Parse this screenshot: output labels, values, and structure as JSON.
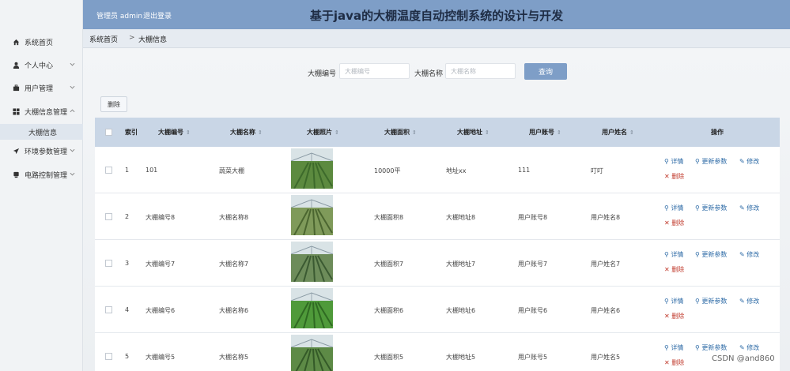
{
  "header": {
    "user": "管理员 admin",
    "logout": "退出登录",
    "title": "基于java的大棚温度自动控制系统的设计与开发"
  },
  "sidebar": {
    "items": [
      {
        "icon": "home-icon",
        "label": "系统首页",
        "chevron": ""
      },
      {
        "icon": "user-icon",
        "label": "个人中心",
        "chevron": "v"
      },
      {
        "icon": "briefcase-icon",
        "label": "用户管理",
        "chevron": "v"
      },
      {
        "icon": "grid-icon",
        "label": "大棚信息管理",
        "chevron": "^"
      },
      {
        "icon": "send-icon",
        "label": "环境参数管理",
        "chevron": "v"
      },
      {
        "icon": "database-icon",
        "label": "电路控制管理",
        "chevron": "v"
      }
    ],
    "subitem": "大棚信息"
  },
  "breadcrumb": {
    "home": "系统首页",
    "separator": ">",
    "current": "大棚信息"
  },
  "search": {
    "no_label": "大棚编号",
    "no_placeholder": "大棚编号",
    "name_label": "大棚名称",
    "name_placeholder": "大棚名称",
    "query_button": "查询"
  },
  "toolbar": {
    "delete_button": "删除"
  },
  "table": {
    "columns": {
      "index": "索引",
      "no": "大棚编号",
      "name": "大棚名称",
      "photo": "大棚照片",
      "area": "大棚面积",
      "address": "大棚地址",
      "account": "用户账号",
      "username": "用户姓名",
      "ops": "操作"
    },
    "rows": [
      {
        "index": "1",
        "no": "101",
        "name": "蔬菜大棚",
        "area": "10000平",
        "address": "地址xx",
        "account": "111",
        "username": "叮叮"
      },
      {
        "index": "2",
        "no": "大棚编号8",
        "name": "大棚名称8",
        "area": "大棚面积8",
        "address": "大棚地址8",
        "account": "用户账号8",
        "username": "用户姓名8"
      },
      {
        "index": "3",
        "no": "大棚编号7",
        "name": "大棚名称7",
        "area": "大棚面积7",
        "address": "大棚地址7",
        "account": "用户账号7",
        "username": "用户姓名7"
      },
      {
        "index": "4",
        "no": "大棚编号6",
        "name": "大棚名称6",
        "area": "大棚面积6",
        "address": "大棚地址6",
        "account": "用户账号6",
        "username": "用户姓名6"
      },
      {
        "index": "5",
        "no": "大棚编号5",
        "name": "大棚名称5",
        "area": "大棚面积5",
        "address": "大棚地址5",
        "account": "用户账号5",
        "username": "用户姓名5"
      }
    ],
    "actions": {
      "detail": "详情",
      "update": "更新参数",
      "edit": "修改",
      "delete": "删除"
    }
  },
  "watermark": "CSDN @and860",
  "colors": {
    "accent": "#7e9ec7",
    "header_text": "#1e2c44",
    "link": "#2c6aa6",
    "danger": "#c0392b"
  }
}
